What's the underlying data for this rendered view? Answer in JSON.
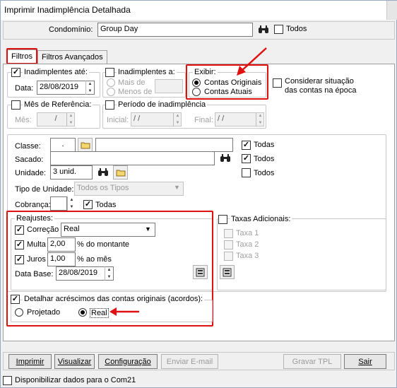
{
  "window": {
    "title": "Imprimir Inadimplência Detalhada"
  },
  "condominio": {
    "label": "Condomínio:",
    "value": "Group Day",
    "todos_label": "Todos"
  },
  "tabs": [
    {
      "label": "Filtros"
    },
    {
      "label": "Filtros Avançados"
    }
  ],
  "inadimplentes_ate": {
    "label": "Inadimplentes até:",
    "data_label": "Data:",
    "data_value": "28/08/2019"
  },
  "inadimplentes_a": {
    "label": "Inadimplentes a:",
    "mais_de": "Mais de",
    "menos_de": "Menos de"
  },
  "exibir": {
    "legend": "Exibir:",
    "option1": "Contas Originais",
    "option2": "Contas Atuais"
  },
  "considerar": {
    "line1": "Considerar situação",
    "line2": "das contas na época"
  },
  "mes_referencia": {
    "label": "Mês de Referência:",
    "mes_label": "Mês:",
    "mes_value": "/"
  },
  "periodo": {
    "label": "Período de inadimplência",
    "inicial_label": "Inicial:",
    "inicial_value": "/ /",
    "final_label": "Final:",
    "final_value": "/ /"
  },
  "classe": {
    "label": "Classe:",
    "code": ".",
    "todas": "Todas"
  },
  "sacado": {
    "label": "Sacado:",
    "todos": "Todos"
  },
  "unidade": {
    "label": "Unidade:",
    "value": "3 unid.",
    "todos": "Todos"
  },
  "tipo_unidade": {
    "label": "Tipo de Unidade:",
    "value": "Todos os Tipos"
  },
  "cobranca": {
    "label": "Cobrança:",
    "todas": "Todas"
  },
  "reajustes": {
    "legend": "Reajustes:",
    "correcao_label": "Correção",
    "correcao_value": "Real",
    "multa_label": "Multa",
    "multa_value": "2,00",
    "multa_suffix": "% do montante",
    "juros_label": "Juros",
    "juros_value": "1,00",
    "juros_suffix": "% ao mês",
    "data_base_label": "Data Base:",
    "data_base_value": "28/08/2019"
  },
  "taxas": {
    "label": "Taxas Adicionais:",
    "taxa1": "Taxa 1",
    "taxa2": "Taxa 2",
    "taxa3": "Taxa 3"
  },
  "detalhar": {
    "label": "Detalhar acréscimos das contas originais (acordos):",
    "projetado": "Projetado",
    "real": "Real"
  },
  "buttons": {
    "imprimir": "Imprimir",
    "visualizar": "Visualizar",
    "configuracao": "Configuração",
    "enviar_email": "Enviar E-mail",
    "gravar_tpl": "Gravar TPL",
    "sair": "Sair"
  },
  "footer": {
    "disponibilizar": "Disponibilizar dados para o Com21"
  },
  "colors": {
    "highlight": "#e01010",
    "window_bg": "#f0f0f0"
  }
}
